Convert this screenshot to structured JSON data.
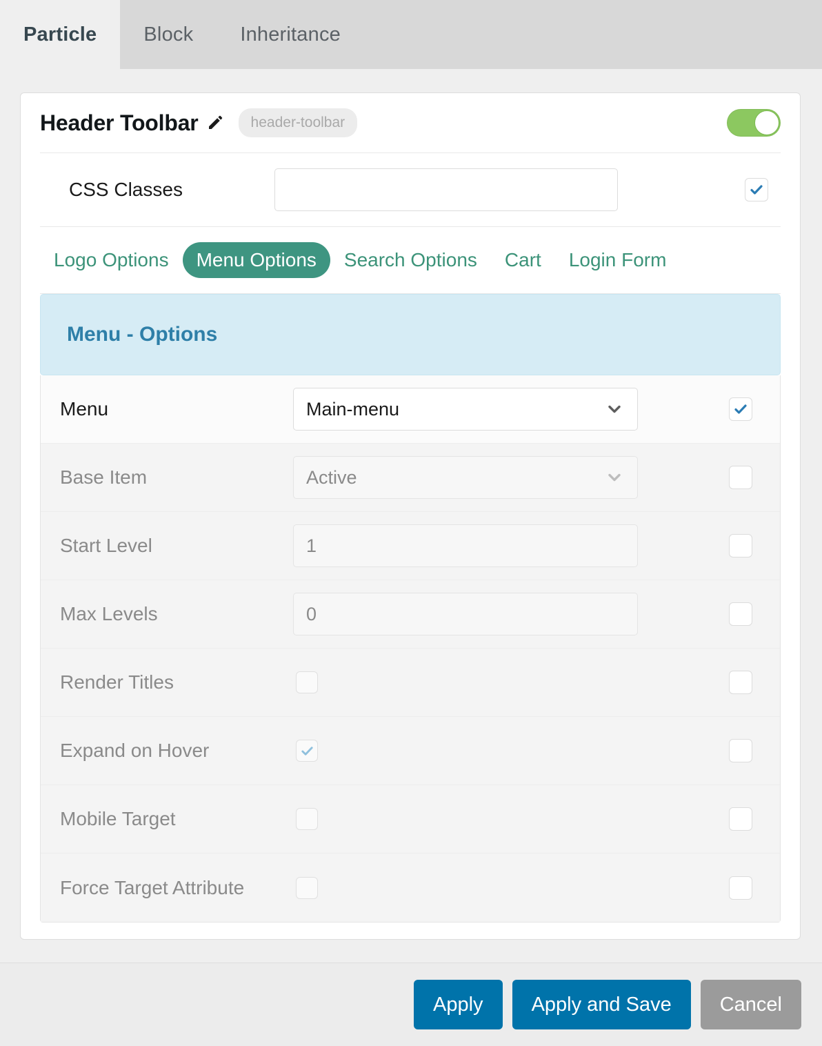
{
  "tabs": [
    {
      "label": "Particle",
      "active": true
    },
    {
      "label": "Block",
      "active": false
    },
    {
      "label": "Inheritance",
      "active": false
    }
  ],
  "header": {
    "title": "Header Toolbar",
    "edit_icon": "pencil-icon",
    "tag": "header-toolbar",
    "enabled_toggle": true
  },
  "css_classes": {
    "label": "CSS Classes",
    "value": "",
    "placeholder": "",
    "override_checked": true
  },
  "subtabs": [
    {
      "label": "Logo Options",
      "active": false
    },
    {
      "label": "Menu Options",
      "active": true
    },
    {
      "label": "Search Options",
      "active": false
    },
    {
      "label": "Cart",
      "active": false
    },
    {
      "label": "Login Form",
      "active": false
    }
  ],
  "panel": {
    "title": "Menu - Options",
    "rows": [
      {
        "label": "Menu",
        "type": "select",
        "value": "Main-menu",
        "disabled": false,
        "override_checked": true
      },
      {
        "label": "Base Item",
        "type": "select",
        "value": "Active",
        "disabled": true,
        "override_checked": false
      },
      {
        "label": "Start Level",
        "type": "input",
        "value": "1",
        "disabled": true,
        "override_checked": false
      },
      {
        "label": "Max Levels",
        "type": "input",
        "value": "0",
        "disabled": true,
        "override_checked": false
      },
      {
        "label": "Render Titles",
        "type": "checkbox",
        "checked": false,
        "disabled": true,
        "override_checked": false
      },
      {
        "label": "Expand on Hover",
        "type": "checkbox",
        "checked": true,
        "disabled": true,
        "override_checked": false
      },
      {
        "label": "Mobile Target",
        "type": "checkbox",
        "checked": false,
        "disabled": true,
        "override_checked": false
      },
      {
        "label": "Force Target Attribute",
        "type": "checkbox",
        "checked": false,
        "disabled": true,
        "override_checked": false
      }
    ]
  },
  "footer": {
    "apply": "Apply",
    "apply_and_save": "Apply and Save",
    "cancel": "Cancel"
  },
  "colors": {
    "accent_teal": "#3e9581",
    "panel_blue_bg": "#d6ecf5",
    "panel_blue_text": "#2e7fa8",
    "toggle_green": "#8cc860",
    "button_blue": "#0073aa",
    "button_grey": "#9b9b9b",
    "check_blue": "#2b7cb4"
  }
}
